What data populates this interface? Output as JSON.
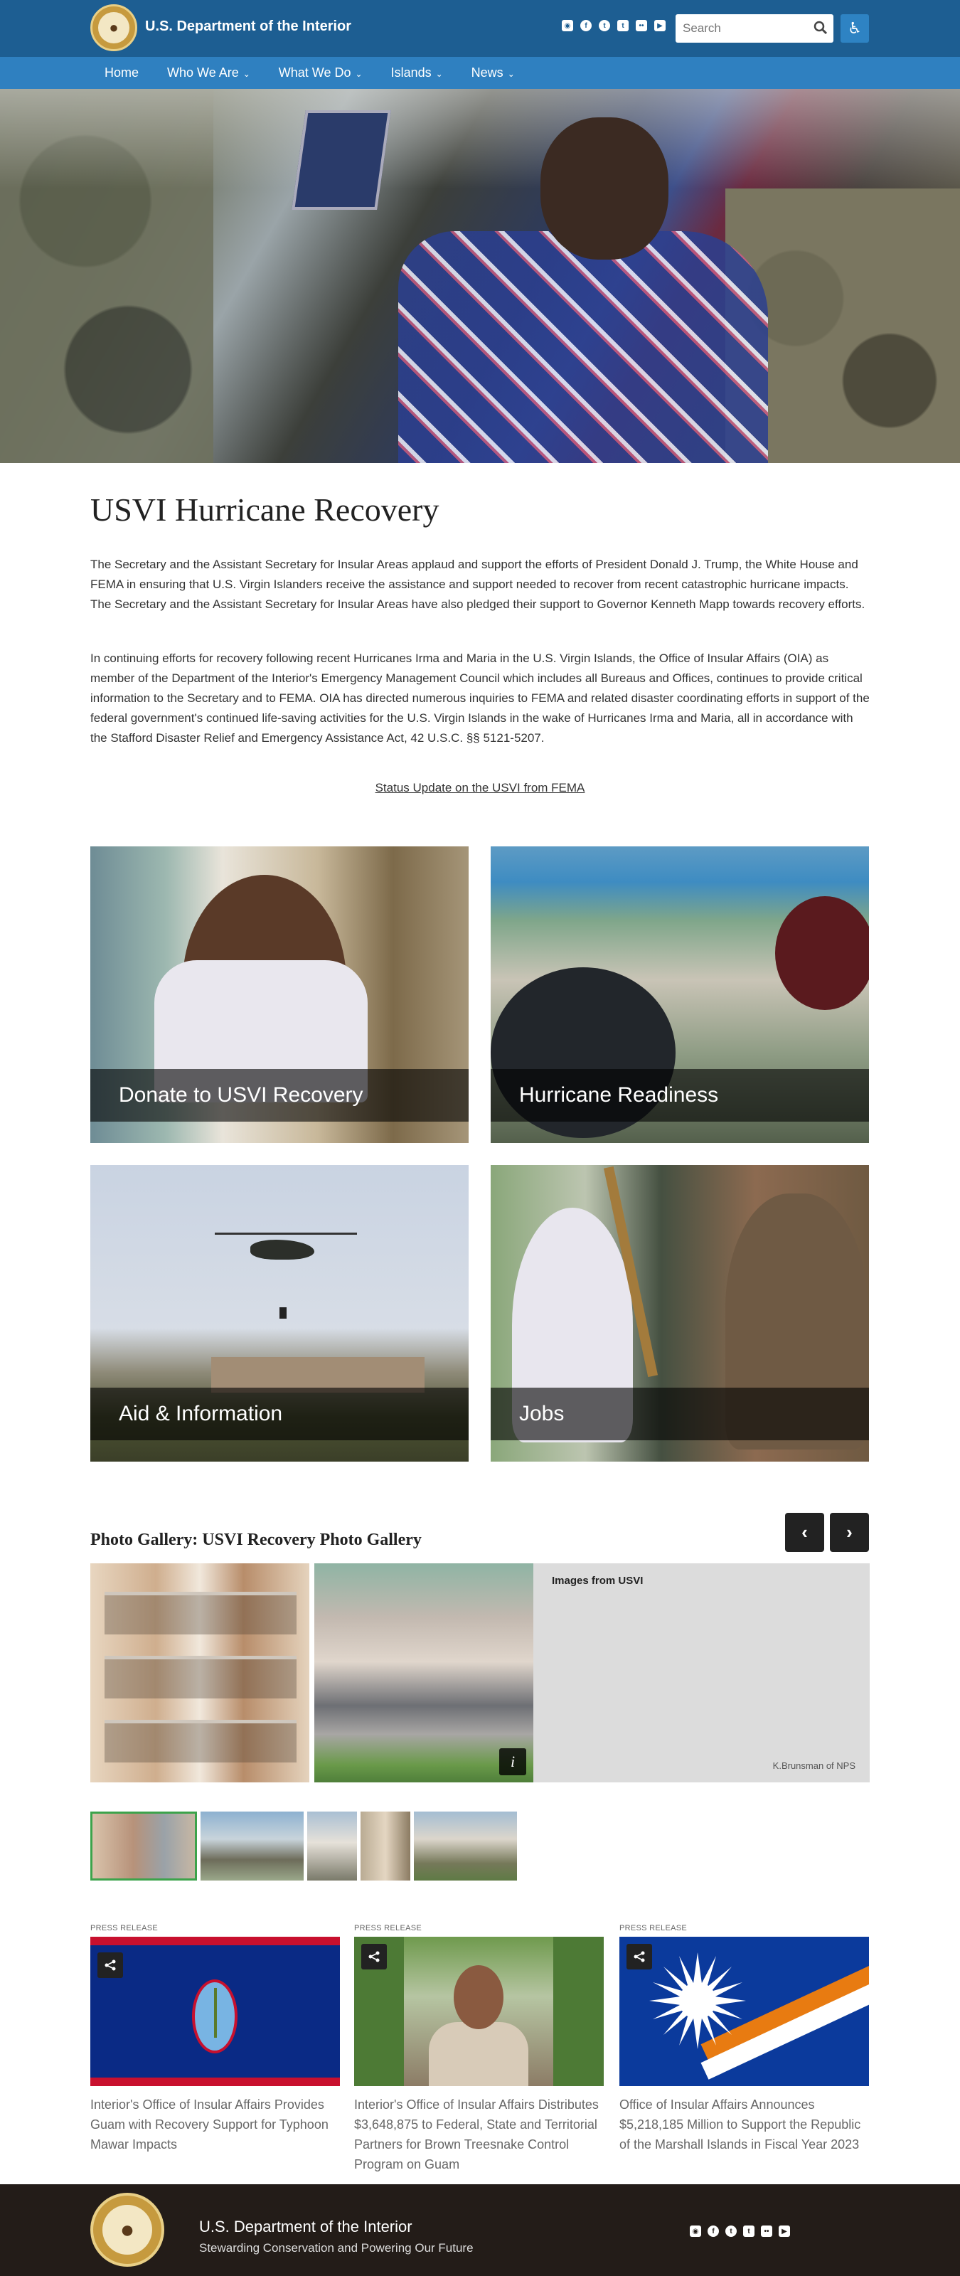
{
  "header": {
    "site_name": "U.S. Department of the Interior",
    "search_placeholder": "Search",
    "social_icons": [
      "instagram-icon",
      "facebook-icon",
      "twitter-icon",
      "tumblr-icon",
      "flickr-icon",
      "youtube-icon"
    ]
  },
  "nav": {
    "items": [
      {
        "label": "Home",
        "has_dropdown": false
      },
      {
        "label": "Who We Are",
        "has_dropdown": true
      },
      {
        "label": "What We Do",
        "has_dropdown": true
      },
      {
        "label": "Islands",
        "has_dropdown": true
      },
      {
        "label": "News",
        "has_dropdown": true
      }
    ]
  },
  "main": {
    "title": "USVI Hurricane Recovery",
    "paragraphs": [
      "The Secretary and the Assistant Secretary for Insular Areas applaud and support the efforts of President Donald J. Trump, the White House and FEMA in ensuring that U.S. Virgin Islanders receive the assistance and support needed to recover from recent catastrophic hurricane impacts.  The Secretary and the Assistant Secretary for Insular Areas have also pledged their support to Governor Kenneth Mapp towards recovery efforts.",
      "In continuing efforts for recovery following recent Hurricanes Irma and Maria in the U.S. Virgin Islands, the Office of Insular Affairs (OIA) as member of the Department of the Interior's Emergency Management Council which includes all Bureaus and Offices, continues to provide critical information to the Secretary and to FEMA.  OIA has directed numerous inquiries to FEMA and related disaster coordinating efforts in support of the federal government's continued life-saving activities for the U.S. Virgin Islands in the wake of Hurricanes Irma and Maria, all in accordance with the Stafford Disaster Relief and Emergency Assistance Act, 42 U.S.C. §§ 5121-5207."
    ],
    "fema_link": "Status Update on the USVI from FEMA"
  },
  "tiles": [
    {
      "label": "Donate to USVI Recovery"
    },
    {
      "label": "Hurricane Readiness"
    },
    {
      "label": "Aid & Information"
    },
    {
      "label": "Jobs"
    }
  ],
  "gallery": {
    "title": "Photo Gallery: USVI Recovery Photo Gallery",
    "caption_heading": "Images from USVI",
    "credit": "K.Brunsman of NPS",
    "prev_label": "‹",
    "next_label": "›",
    "info_label": "i",
    "thumbnail_count": 5,
    "selected_thumbnail": 1
  },
  "news": [
    {
      "kicker": "PRESS RELEASE",
      "headline": "Interior's Office of Insular Affairs Provides Guam with Recovery Support for Typhoon Mawar Impacts"
    },
    {
      "kicker": "PRESS RELEASE",
      "headline": "Interior's Office of Insular Affairs Distributes $3,648,875 to Federal, State and Territorial Partners for Brown Treesnake Control Program on Guam"
    },
    {
      "kicker": "PRESS RELEASE",
      "headline": "Office of Insular Affairs Announces $5,218,185 Million to Support the Republic of the Marshall Islands in Fiscal Year 2023"
    }
  ],
  "footer": {
    "name": "U.S. Department of the Interior",
    "tagline": "Stewarding Conservation and Powering Our Future"
  },
  "colors": {
    "topbar": "#1d5e92",
    "nav": "#2f80c0",
    "footer": "#231c18",
    "thumb_selected_border": "#3ca34b"
  }
}
